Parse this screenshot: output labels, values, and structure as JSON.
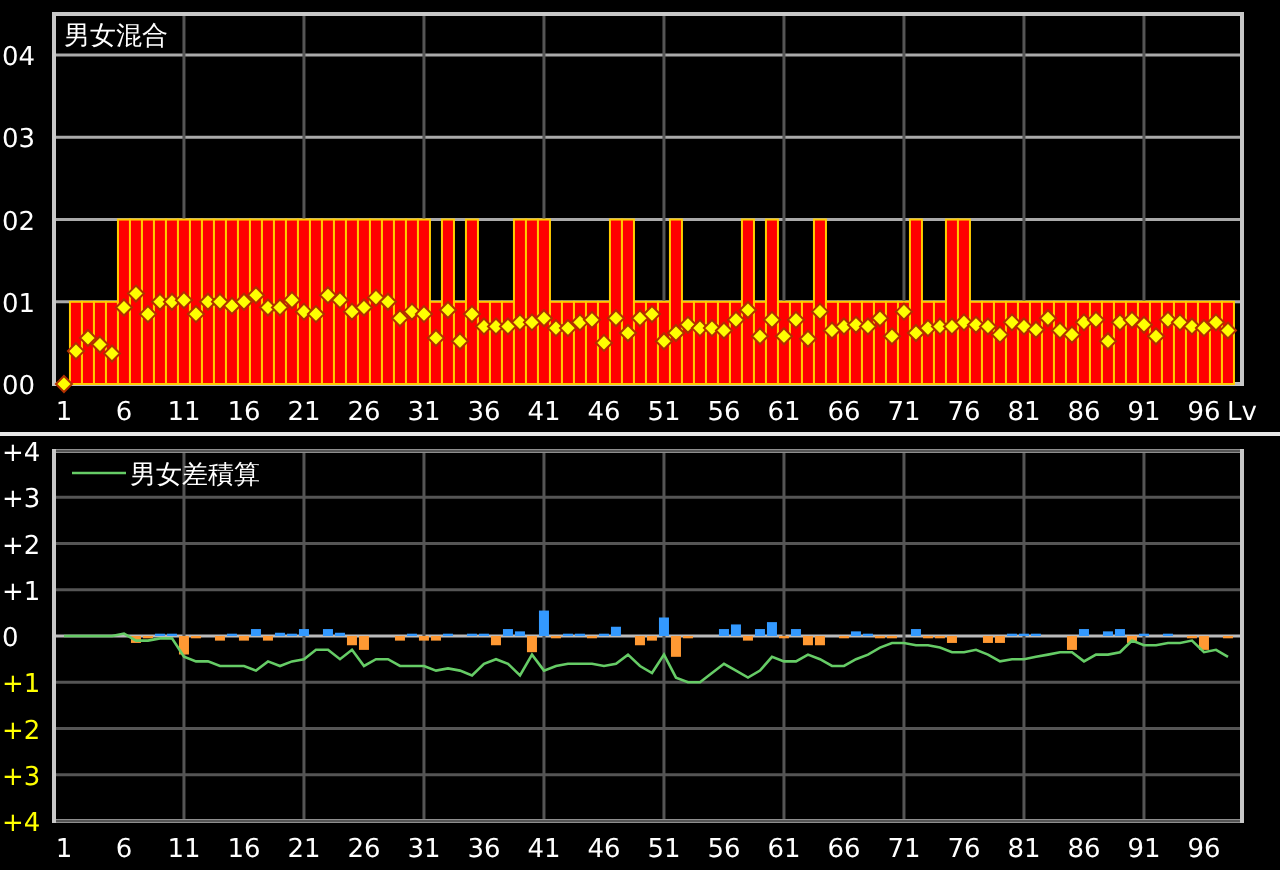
{
  "top_chart": {
    "chart_data": {
      "type": "bar",
      "title": "男女混合",
      "xlabel": "Lv",
      "grid": true,
      "x": [
        1,
        2,
        3,
        4,
        5,
        6,
        7,
        8,
        9,
        10,
        11,
        12,
        13,
        14,
        15,
        16,
        17,
        18,
        19,
        20,
        21,
        22,
        23,
        24,
        25,
        26,
        27,
        28,
        29,
        30,
        31,
        32,
        33,
        34,
        35,
        36,
        37,
        38,
        39,
        40,
        41,
        42,
        43,
        44,
        45,
        46,
        47,
        48,
        49,
        50,
        51,
        52,
        53,
        54,
        55,
        56,
        57,
        58,
        59,
        60,
        61,
        62,
        63,
        64,
        65,
        66,
        67,
        68,
        69,
        70,
        71,
        72,
        73,
        74,
        75,
        76,
        77,
        78,
        79,
        80,
        81,
        82,
        83,
        84,
        85,
        86,
        87,
        88,
        89,
        90,
        91,
        92,
        93,
        94,
        95,
        96,
        97,
        98
      ],
      "xlim": [
        0.17,
        99.17
      ],
      "ylim": [
        0,
        4.5
      ],
      "xticks": [
        1,
        6,
        11,
        16,
        21,
        26,
        31,
        36,
        41,
        46,
        51,
        56,
        61,
        66,
        71,
        76,
        81,
        86,
        91,
        96
      ],
      "yticks": [
        {
          "value": 0,
          "label": "00"
        },
        {
          "value": 1,
          "label": "01"
        },
        {
          "value": 2,
          "label": "02"
        },
        {
          "value": 3,
          "label": "03"
        },
        {
          "value": 4,
          "label": "04"
        }
      ],
      "series": [
        {
          "type": "bar",
          "color": "#ff0000",
          "values": [
            0,
            1,
            1,
            1,
            1,
            2,
            2,
            2,
            2,
            2,
            2,
            2,
            2,
            2,
            2,
            2,
            2,
            2,
            2,
            2,
            2,
            2,
            2,
            2,
            2,
            2,
            2,
            2,
            2,
            2,
            2,
            1,
            2,
            1,
            2,
            1,
            1,
            1,
            2,
            2,
            2,
            1,
            1,
            1,
            1,
            1,
            2,
            2,
            1,
            1,
            1,
            2,
            1,
            1,
            1,
            1,
            1,
            2,
            1,
            2,
            1,
            1,
            1,
            2,
            1,
            1,
            1,
            1,
            1,
            1,
            1,
            2,
            1,
            1,
            2,
            2,
            1,
            1,
            1,
            1,
            1,
            1,
            1,
            1,
            1,
            1,
            1,
            1,
            1,
            1,
            1,
            1,
            1,
            1,
            1,
            1,
            1,
            1
          ]
        },
        {
          "type": "scatter",
          "color": "#ffff00",
          "values": [
            0,
            0.4,
            0.56,
            0.48,
            0.37,
            0.93,
            1.1,
            0.85,
            1,
            1,
            1.02,
            0.85,
            1,
            1,
            0.95,
            1,
            1.08,
            0.93,
            0.93,
            1.02,
            0.88,
            0.85,
            1.08,
            1.02,
            0.88,
            0.93,
            1.05,
            1,
            0.8,
            0.88,
            0.85,
            0.56,
            0.9,
            0.52,
            0.85,
            0.7,
            0.7,
            0.7,
            0.75,
            0.75,
            0.8,
            0.68,
            0.68,
            0.75,
            0.78,
            0.5,
            0.8,
            0.62,
            0.8,
            0.85,
            0.52,
            0.62,
            0.72,
            0.68,
            0.68,
            0.65,
            0.78,
            0.9,
            0.58,
            0.78,
            0.58,
            0.78,
            0.55,
            0.88,
            0.65,
            0.7,
            0.72,
            0.7,
            0.8,
            0.58,
            0.88,
            0.62,
            0.68,
            0.7,
            0.7,
            0.75,
            0.72,
            0.7,
            0.6,
            0.75,
            0.7,
            0.66,
            0.8,
            0.65,
            0.6,
            0.75,
            0.78,
            0.52,
            0.75,
            0.78,
            0.72,
            0.58,
            0.78,
            0.75,
            0.7,
            0.68,
            0.75,
            0.65
          ]
        }
      ]
    }
  },
  "bottom_chart": {
    "chart_data": {
      "type": "bar",
      "grid": true,
      "x": [
        1,
        2,
        3,
        4,
        5,
        6,
        7,
        8,
        9,
        10,
        11,
        12,
        13,
        14,
        15,
        16,
        17,
        18,
        19,
        20,
        21,
        22,
        23,
        24,
        25,
        26,
        27,
        28,
        29,
        30,
        31,
        32,
        33,
        34,
        35,
        36,
        37,
        38,
        39,
        40,
        41,
        42,
        43,
        44,
        45,
        46,
        47,
        48,
        49,
        50,
        51,
        52,
        53,
        54,
        55,
        56,
        57,
        58,
        59,
        60,
        61,
        62,
        63,
        64,
        65,
        66,
        67,
        68,
        69,
        70,
        71,
        72,
        73,
        74,
        75,
        76,
        77,
        78,
        79,
        80,
        81,
        82,
        83,
        84,
        85,
        86,
        87,
        88,
        89,
        90,
        91,
        92,
        93,
        94,
        95,
        96,
        97,
        98
      ],
      "xlim": [
        0.17,
        99.17
      ],
      "ylim": [
        -4,
        4
      ],
      "xticks": [
        1,
        6,
        11,
        16,
        21,
        26,
        31,
        36,
        41,
        46,
        51,
        56,
        61,
        66,
        71,
        76,
        81,
        86,
        91,
        96
      ],
      "yticks": [
        {
          "value": 4,
          "label": "+4"
        },
        {
          "value": 3,
          "label": "+3"
        },
        {
          "value": 2,
          "label": "+2"
        },
        {
          "value": 1,
          "label": "+1"
        },
        {
          "value": 0,
          "label": "0"
        },
        {
          "value": -1,
          "label": "+1"
        },
        {
          "value": -2,
          "label": "+2"
        },
        {
          "value": -3,
          "label": "+3"
        },
        {
          "value": -4,
          "label": "+4"
        }
      ],
      "series": [
        {
          "type": "bar",
          "color": "#3399ff",
          "values": [
            null,
            null,
            null,
            null,
            null,
            null,
            null,
            null,
            0.05,
            0.05,
            null,
            null,
            null,
            null,
            0.05,
            null,
            0.15,
            null,
            0.07,
            0.05,
            0.15,
            null,
            0.15,
            0.07,
            null,
            null,
            null,
            null,
            null,
            0.05,
            null,
            null,
            0.05,
            null,
            0.05,
            0.05,
            null,
            0.15,
            0.1,
            null,
            0.55,
            null,
            0.05,
            0.05,
            null,
            0.05,
            0.2,
            null,
            null,
            null,
            0.4,
            null,
            null,
            null,
            null,
            0.15,
            0.25,
            null,
            0.15,
            0.3,
            null,
            0.15,
            null,
            null,
            null,
            null,
            0.1,
            0.05,
            null,
            null,
            null,
            0.15,
            null,
            null,
            null,
            null,
            null,
            null,
            null,
            0.05,
            0.05,
            0.05,
            null,
            null,
            null,
            0.15,
            null,
            0.1,
            0.15,
            null,
            0.05,
            null,
            0.05,
            null,
            null,
            null,
            null,
            null
          ]
        },
        {
          "type": "bar",
          "color": "#ff9933",
          "values": [
            null,
            null,
            null,
            null,
            null,
            null,
            -0.15,
            -0.05,
            null,
            null,
            -0.4,
            -0.05,
            null,
            -0.1,
            null,
            -0.1,
            null,
            -0.1,
            null,
            null,
            null,
            null,
            null,
            null,
            -0.2,
            -0.3,
            null,
            null,
            -0.1,
            null,
            -0.1,
            -0.1,
            null,
            null,
            null,
            null,
            -0.2,
            null,
            null,
            -0.35,
            null,
            -0.05,
            null,
            null,
            -0.05,
            null,
            null,
            null,
            -0.2,
            -0.1,
            null,
            -0.45,
            -0.05,
            null,
            null,
            null,
            null,
            -0.1,
            null,
            null,
            -0.05,
            null,
            -0.2,
            -0.2,
            null,
            -0.05,
            null,
            null,
            -0.05,
            -0.05,
            null,
            null,
            -0.05,
            -0.05,
            -0.15,
            null,
            null,
            -0.15,
            -0.15,
            null,
            null,
            null,
            null,
            null,
            -0.3,
            null,
            null,
            null,
            null,
            -0.15,
            null,
            null,
            null,
            null,
            -0.05,
            -0.3,
            null,
            -0.05
          ]
        },
        {
          "type": "line",
          "name": "男女差積算",
          "color": "#66cc66",
          "values": [
            0,
            0,
            0,
            0,
            0,
            0.05,
            -0.1,
            -0.1,
            -0.05,
            -0.05,
            -0.45,
            -0.55,
            -0.55,
            -0.65,
            -0.65,
            -0.65,
            -0.75,
            -0.55,
            -0.65,
            -0.55,
            -0.5,
            -0.3,
            -0.3,
            -0.5,
            -0.3,
            -0.65,
            -0.5,
            -0.5,
            -0.65,
            -0.65,
            -0.65,
            -0.75,
            -0.7,
            -0.75,
            -0.85,
            -0.6,
            -0.5,
            -0.6,
            -0.85,
            -0.4,
            -0.75,
            -0.65,
            -0.6,
            -0.6,
            -0.6,
            -0.65,
            -0.6,
            -0.4,
            -0.65,
            -0.8,
            -0.4,
            -0.9,
            -1.0,
            -1.0,
            -0.8,
            -0.6,
            -0.75,
            -0.9,
            -0.75,
            -0.45,
            -0.55,
            -0.55,
            -0.4,
            -0.5,
            -0.65,
            -0.65,
            -0.5,
            -0.4,
            -0.25,
            -0.15,
            -0.15,
            -0.2,
            -0.2,
            -0.25,
            -0.35,
            -0.35,
            -0.3,
            -0.4,
            -0.55,
            -0.5,
            -0.5,
            -0.45,
            -0.4,
            -0.35,
            -0.35,
            -0.55,
            -0.4,
            -0.4,
            -0.35,
            -0.1,
            -0.2,
            -0.2,
            -0.15,
            -0.15,
            -0.1,
            -0.35,
            -0.3,
            -0.45
          ]
        }
      ]
    }
  }
}
